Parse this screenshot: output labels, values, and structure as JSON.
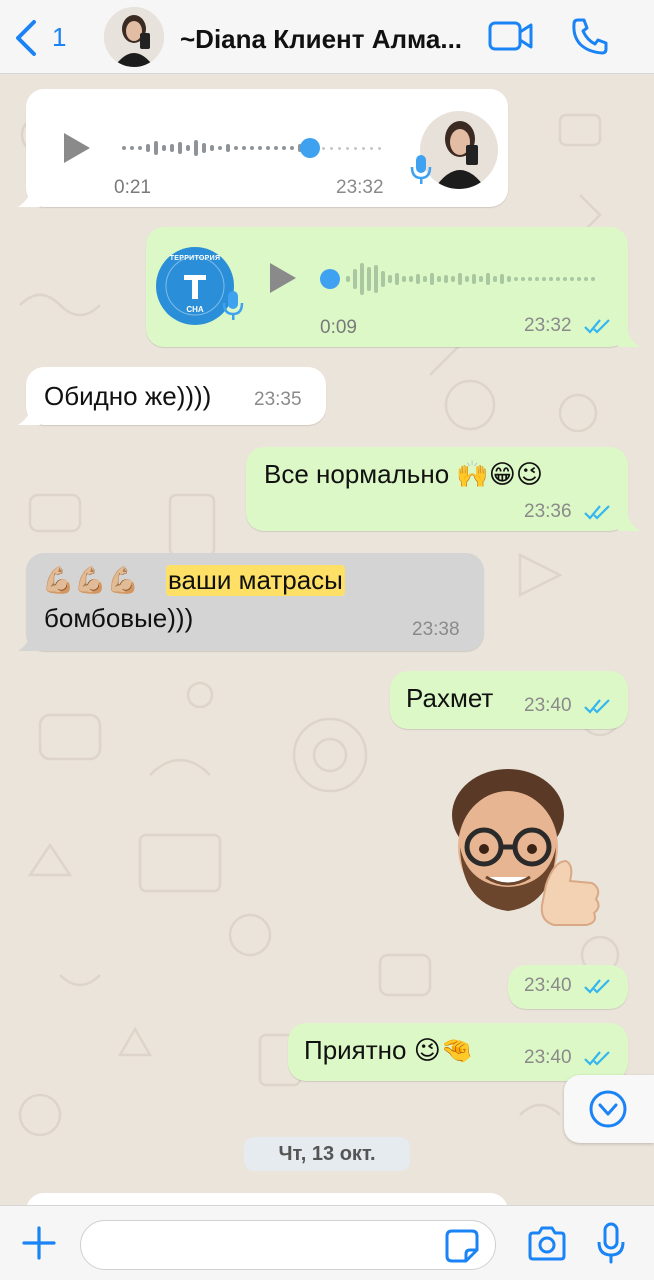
{
  "header": {
    "back_count": "1",
    "contact_name": "~Diana Клиент Алма..."
  },
  "messages": {
    "m1": {
      "duration": "0:21",
      "time": "23:32"
    },
    "m2": {
      "duration": "0:09",
      "time": "23:32",
      "avatar_text_top": "ТЕРРИТОРИЯ",
      "avatar_letter": "Т",
      "avatar_text_bottom": "СНА"
    },
    "m3": {
      "text": "Обидно же))))",
      "time": "23:35"
    },
    "m4": {
      "text": "Все нормально 🙌😁😉",
      "time": "23:36"
    },
    "m5": {
      "emoji": "💪🏼💪🏼💪🏼",
      "highlight": "ваши матрасы",
      "line2": "бомбовые)))",
      "time": "23:38"
    },
    "m6": {
      "text": "Рахмет",
      "time": "23:40"
    },
    "m7": {
      "time": "23:40"
    },
    "m8": {
      "text": "Приятно 😉🤏",
      "time": "23:40"
    }
  },
  "date_separator": "Чт, 13 окт.",
  "colors": {
    "accent": "#1a83f5",
    "outgoing_bubble": "#dcf8c6",
    "incoming_bubble": "#ffffff",
    "read_ticks": "#34b7f1",
    "highlight": "#ffe066"
  },
  "icons": {
    "back": "chevron-left-icon",
    "video": "video-camera-icon",
    "call": "phone-icon",
    "scroll": "chevron-down-circle-icon",
    "plus": "plus-icon",
    "sticker": "sticker-icon",
    "camera": "camera-icon",
    "mic": "microphone-icon"
  }
}
